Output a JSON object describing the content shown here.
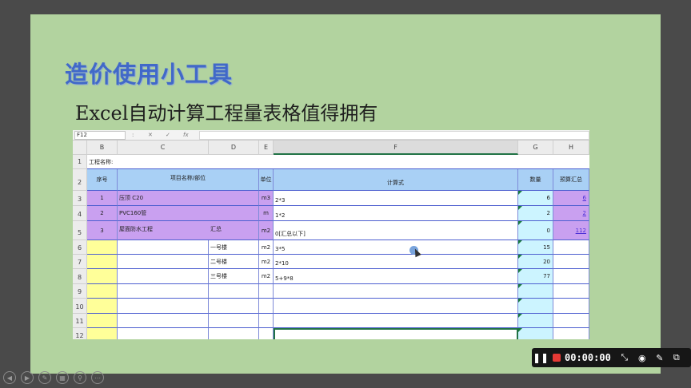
{
  "slide": {
    "title": "造价使用小工具",
    "subtitle": "Excel自动计算工程量表格值得拥有"
  },
  "excel": {
    "name_box": "F12",
    "formula_icons": [
      ":",
      "✕",
      "✓",
      "fx"
    ],
    "columns": [
      "B",
      "C",
      "D",
      "E",
      "F",
      "G",
      "H"
    ],
    "row_numbers": [
      "1",
      "2",
      "3",
      "4",
      "5",
      "6",
      "7",
      "8",
      "9",
      "10",
      "11",
      "12"
    ],
    "project_name_label": "工程名称:",
    "headers": {
      "seq": "序号",
      "item": "项目名称/部位",
      "unit": "单位",
      "formula": "计算式",
      "qty": "数量",
      "budget": "预算汇总"
    },
    "rows": [
      {
        "seq": "1",
        "name": "压顶 C20",
        "part": "",
        "unit": "m3",
        "formula": "2*3",
        "qty": "6",
        "budget": "6"
      },
      {
        "seq": "2",
        "name": "PVC160管",
        "part": "",
        "unit": "m",
        "formula": "1*2",
        "qty": "2",
        "budget": "2"
      },
      {
        "seq": "3",
        "name": "屋面防水工程",
        "part": "汇总",
        "unit": "m2",
        "formula": "0[汇总以下]",
        "qty": "0",
        "budget": "112"
      },
      {
        "seq": "",
        "name": "",
        "part": "一号楼",
        "unit": "m2",
        "formula": "3*5",
        "qty": "15",
        "budget": ""
      },
      {
        "seq": "",
        "name": "",
        "part": "二号楼",
        "unit": "m2",
        "formula": "2*10",
        "qty": "20",
        "budget": ""
      },
      {
        "seq": "",
        "name": "",
        "part": "三号楼",
        "unit": "m2",
        "formula": "5+9*8",
        "qty": "77",
        "budget": ""
      }
    ]
  },
  "recorder": {
    "timer": "00:00:00",
    "colors": {
      "stop": "#e53935",
      "bar": "#161616"
    }
  },
  "colors": {
    "slide_bg": "#b2d39f",
    "title": "#4169c8",
    "header_blue": "#a9d0f5",
    "purple": "#c9a0f0",
    "yellow": "#ffff99",
    "cyan": "#ccf4ff"
  }
}
